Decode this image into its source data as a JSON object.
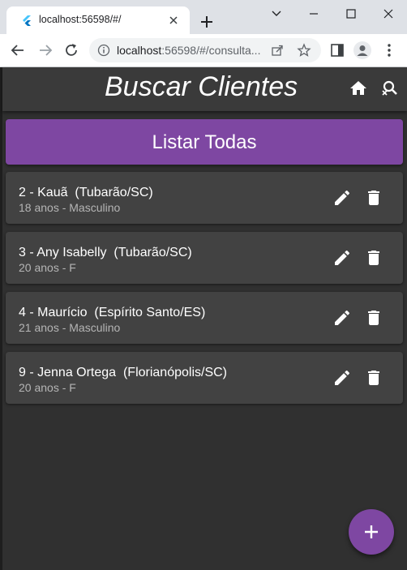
{
  "browser": {
    "tab_title": "localhost:56598/#/",
    "url_host": "localhost",
    "url_rest": ":56598/#/consulta..."
  },
  "app": {
    "title": "Buscar Clientes",
    "list_all_label": "Listar Todas",
    "accent_color": "#7e47a2",
    "clients": [
      {
        "title": "2 - Kauã  (Tubarão/SC)",
        "subtitle": "18 anos - Masculino"
      },
      {
        "title": "3 - Any Isabelly  (Tubarão/SC)",
        "subtitle": "20 anos - F"
      },
      {
        "title": "4 - Maurício  (Espírito Santo/ES)",
        "subtitle": "21 anos - Masculino"
      },
      {
        "title": "9 - Jenna Ortega  (Florianópolis/SC)",
        "subtitle": "20 anos - F"
      }
    ]
  },
  "icons": {
    "home": "home-icon",
    "search_off": "search-off-icon",
    "edit": "edit-icon",
    "delete": "delete-icon",
    "add": "add-icon"
  }
}
